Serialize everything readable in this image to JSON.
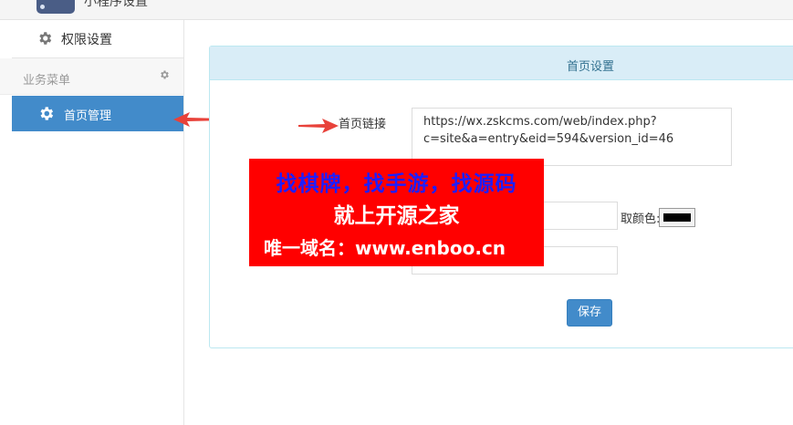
{
  "header": {
    "app_name": "小程序设置",
    "logo_icon": "app-logo-icon"
  },
  "sidebar": {
    "items": [
      {
        "label": "权限设置",
        "icon": "gear-icon",
        "active": false
      }
    ],
    "section": {
      "label": "业务菜单",
      "icon": "gear-icon"
    },
    "section_items": [
      {
        "label": "首页管理",
        "icon": "gear-icon",
        "active": true
      }
    ]
  },
  "panel": {
    "title": "首页设置",
    "home_link": {
      "label": "首页链接",
      "value_line1": "https://wx.zskcms.com/web/index.php?",
      "value_line2": "c=site&a=entry&eid=594&version_id=46"
    },
    "color_picker": {
      "label": "取颜色:",
      "value": "#000000"
    },
    "save_label": "保存"
  },
  "watermark": {
    "line1": "找棋牌，找手游，找源码",
    "line2": "就上开源之家",
    "line3": "唯一域名：www.enboo.cn"
  },
  "colors": {
    "accent": "#428bca",
    "panel_heading_bg": "#d9edf7",
    "watermark_bg": "#ff0000",
    "arrow": "#e8423a"
  }
}
